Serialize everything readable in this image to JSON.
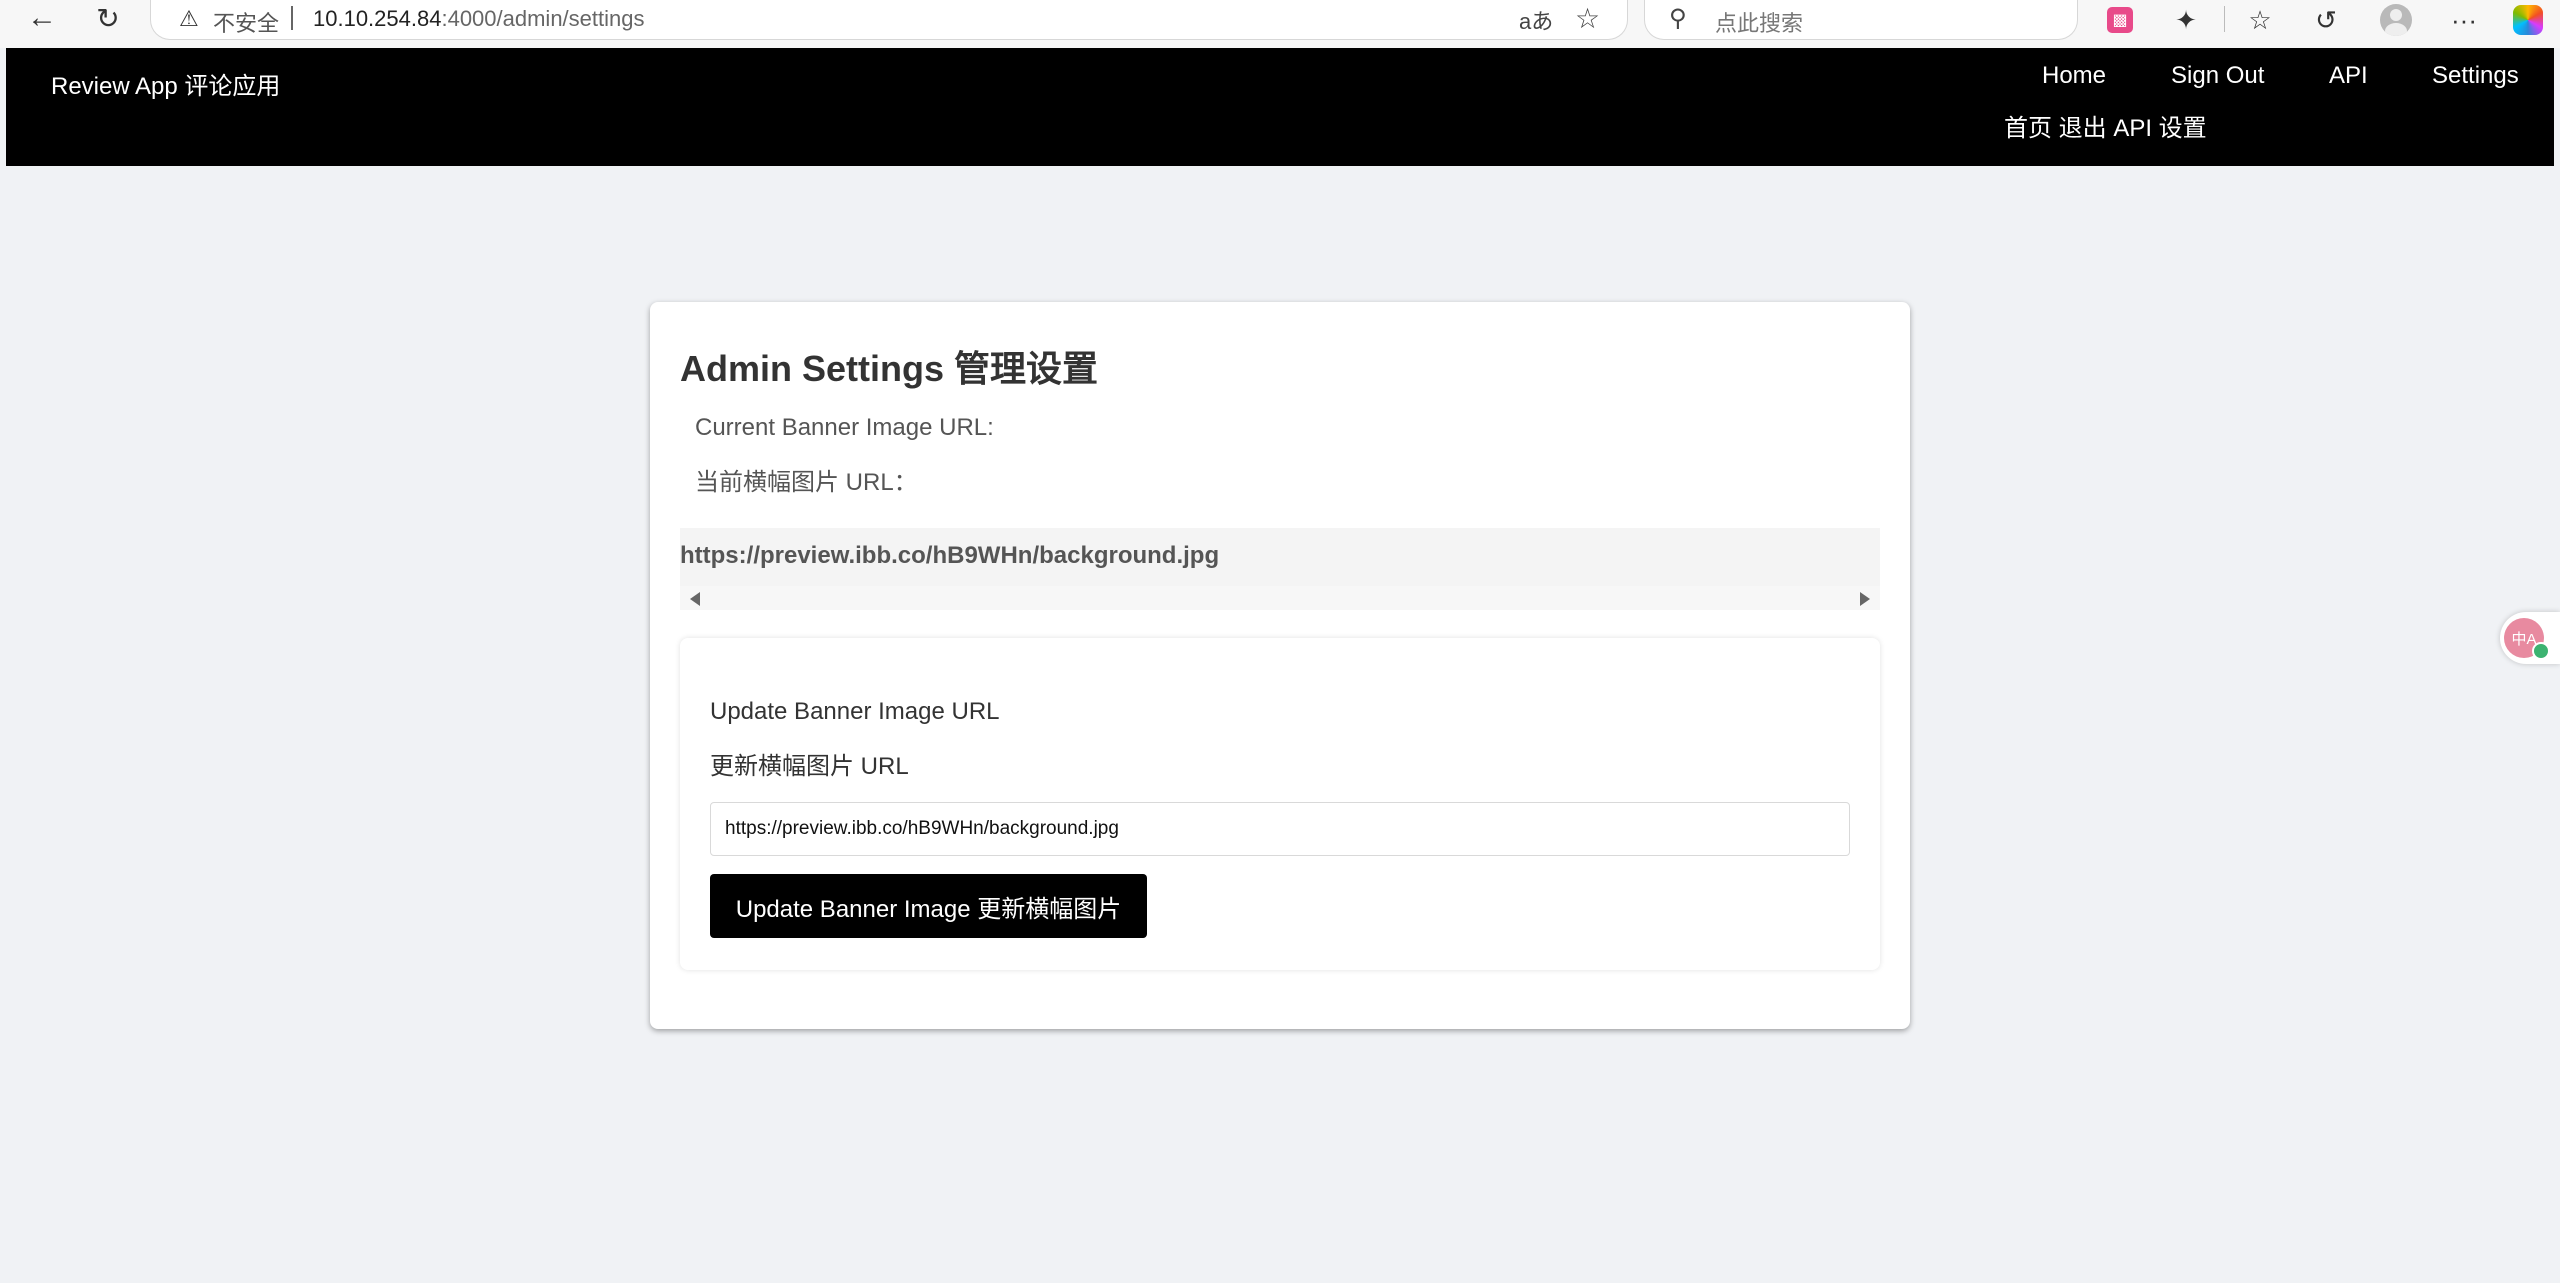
{
  "browser": {
    "insecure_label": "不安全",
    "url_host": "10.10.254.84",
    "url_path": ":4000/admin/settings",
    "search_placeholder": "点此搜索",
    "icons": [
      "back-icon",
      "refresh-icon",
      "warning-icon",
      "read-aloud-icon",
      "favorite-star-icon",
      "search-icon",
      "extension-icon",
      "puzzle-icon",
      "favorites-icon",
      "history-icon",
      "profile-icon",
      "more-icon",
      "copilot-icon"
    ]
  },
  "header": {
    "brand": "Review App  评论应用",
    "nav": {
      "home": "Home",
      "sign_out": "Sign Out",
      "api": "API",
      "settings": "Settings",
      "sub": "首页 退出 API 设置"
    }
  },
  "settings": {
    "title": "Admin Settings  管理设置",
    "current_label": "Current Banner Image URL:",
    "current_label_cn": "当前横幅图片 URL：",
    "current_url": "https://preview.ibb.co/hB9WHn/background.jpg",
    "update_label": "Update Banner Image URL",
    "update_label_cn": "更新横幅图片 URL",
    "input_value": "https://preview.ibb.co/hB9WHn/background.jpg",
    "button_label": "Update Banner Image  更新横幅图片"
  },
  "widget": {
    "label": "中A"
  }
}
